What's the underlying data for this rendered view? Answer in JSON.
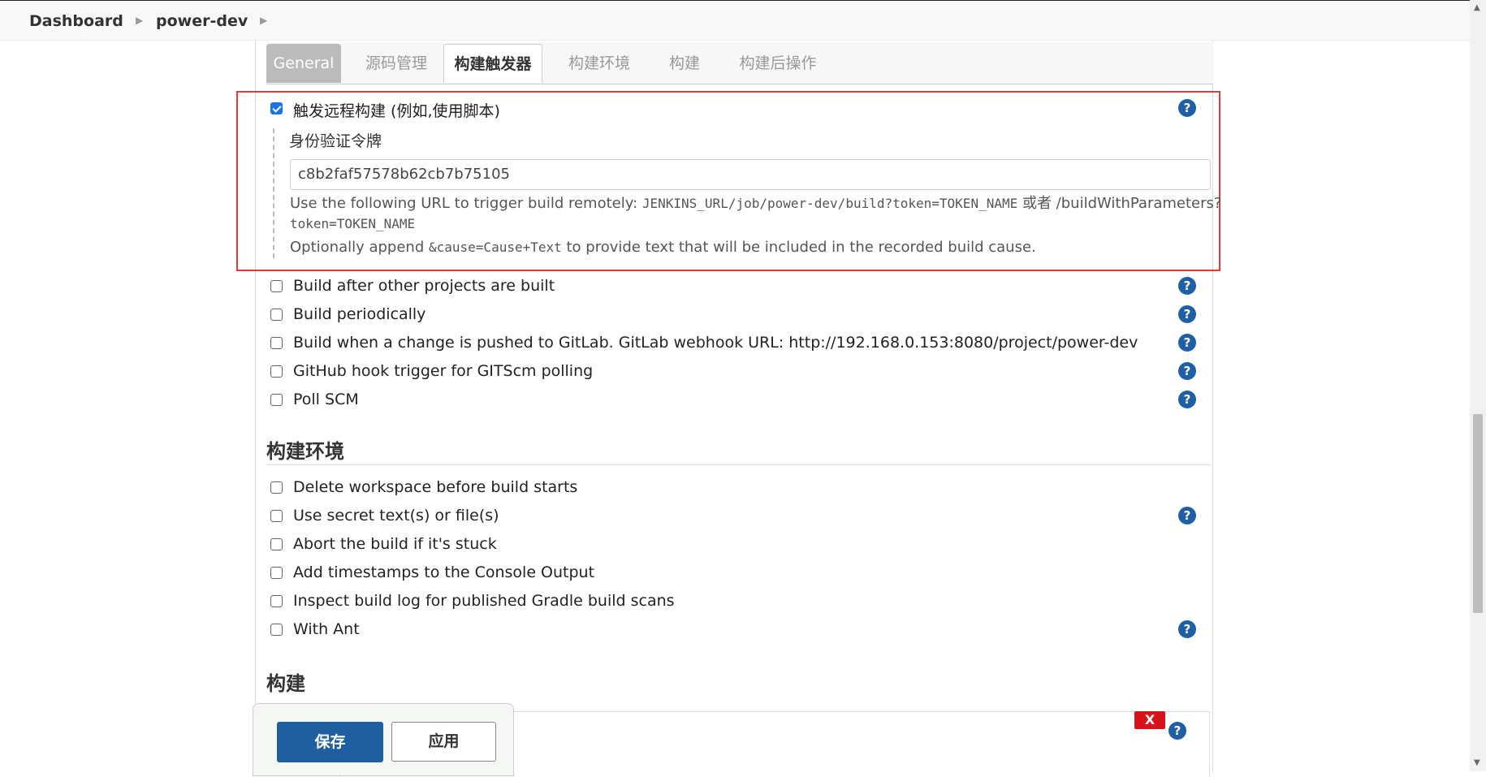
{
  "breadcrumb": {
    "items": [
      "Dashboard",
      "power-dev"
    ]
  },
  "tabs": [
    "General",
    "源码管理",
    "构建触发器",
    "构建环境",
    "构建",
    "构建后操作"
  ],
  "active_tab": "构建触发器",
  "triggers": {
    "remote": {
      "label": "触发远程构建 (例如,使用脚本)",
      "checked": true,
      "token_label": "身份验证令牌",
      "token_value": "c8b2faf57578b62cb7b75105",
      "desc1_prefix": "Use the following URL to trigger build remotely: ",
      "desc1_code": "JENKINS_URL/job/power-dev/build?token=TOKEN_NAME",
      "desc1_mid": " 或者 /buildWithParameters?",
      "desc2_code": "token=TOKEN_NAME",
      "desc3_prefix": "Optionally append ",
      "desc3_code": "&cause=Cause+Text",
      "desc3_suffix": " to provide text that will be included in the recorded build cause."
    },
    "items": [
      "Build after other projects are built",
      "Build periodically",
      "Build when a change is pushed to GitLab. GitLab webhook URL: http://192.168.0.153:8080/project/power-dev",
      "GitHub hook trigger for GITScm polling",
      "Poll SCM"
    ]
  },
  "build_env": {
    "title": "构建环境",
    "items": [
      "Delete workspace before build starts",
      "Use secret text(s) or file(s)",
      "Abort the build if it's stuck",
      "Add timestamps to the Console Output",
      "Inspect build log for published Gradle build scans",
      "With Ant"
    ]
  },
  "build": {
    "title": "构建",
    "remove_label": "X"
  },
  "buttons": {
    "save": "保存",
    "apply": "应用"
  },
  "help_glyph": "?",
  "colors": {
    "accent": "#1e5fa1",
    "highlight_box": "#e53935",
    "danger": "#d9111a"
  }
}
